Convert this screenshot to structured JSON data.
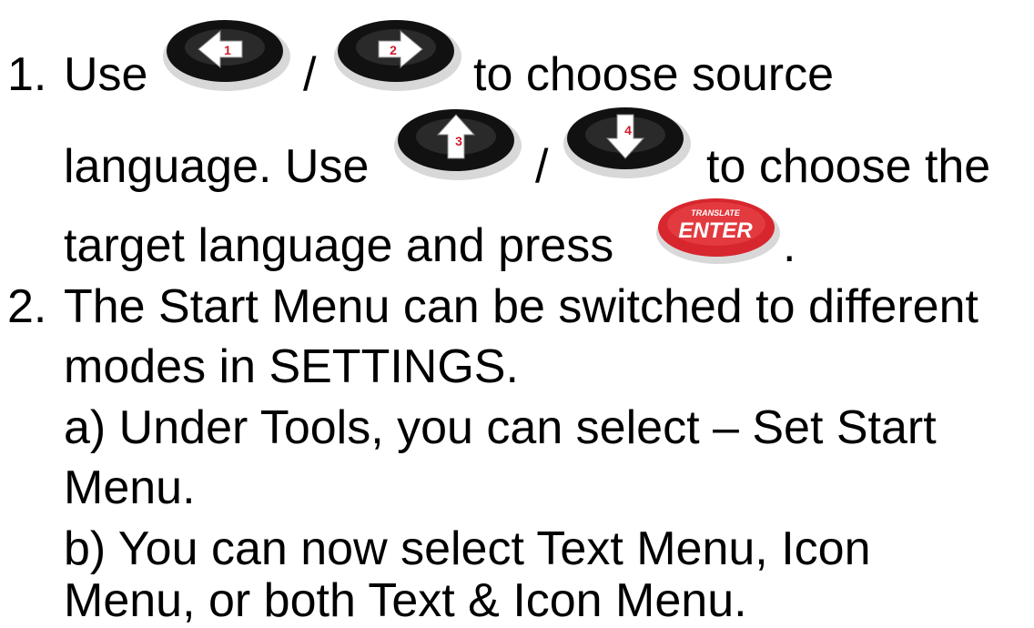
{
  "instructions": {
    "step1": {
      "number": "1.",
      "line1_pre": "Use",
      "line1_sep": "/",
      "line1_post": "to choose source",
      "line2_pre": "language. Use",
      "line2_sep": "/",
      "line2_post": "to choose the",
      "line3_pre": "target language and press",
      "line3_post": ".",
      "buttons": {
        "left": {
          "icon": "arrow-left-icon",
          "digit": "1"
        },
        "right": {
          "icon": "arrow-right-icon",
          "digit": "2"
        },
        "up": {
          "icon": "arrow-up-icon",
          "digit": "3"
        },
        "down": {
          "icon": "arrow-down-icon",
          "digit": "4"
        },
        "enter": {
          "icon": "translate-enter-icon",
          "top_label": "TRANSLATE",
          "label": "ENTER"
        }
      }
    },
    "step2": {
      "number": "2.",
      "line1": "The Start Menu can be switched to different",
      "line2": "modes in SETTINGS.",
      "sub_a_line1": "a) Under Tools, you can select – Set Start",
      "sub_a_line2": "Menu.",
      "sub_b_line1": "b) You can now select Text Menu, Icon",
      "sub_b_line2": "Menu, or both Text & Icon Menu."
    }
  },
  "colors": {
    "text": "#000000",
    "button_body": "#111111",
    "button_digit": "#d01c2c",
    "enter_red": "#d7262e",
    "enter_text": "#ffffff"
  }
}
